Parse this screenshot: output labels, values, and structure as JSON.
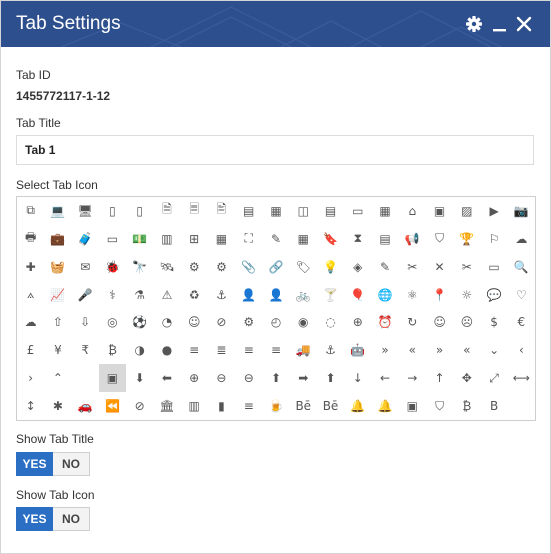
{
  "dialog": {
    "title": "Tab Settings",
    "accent_color": "#2e4f8e",
    "controls": [
      "gear-icon",
      "minimize-icon",
      "close-icon"
    ]
  },
  "tab_id": {
    "label": "Tab ID",
    "value": "1455772117-1-12"
  },
  "tab_title": {
    "label": "Tab Title",
    "value": "Tab 1"
  },
  "icon_picker": {
    "label": "Select Tab Icon",
    "selected_index": 117,
    "selected_color": "#d9d9d9",
    "icons": [
      {
        "name": "files-icon",
        "glyph": "⧉"
      },
      {
        "name": "laptop-icon",
        "glyph": "💻"
      },
      {
        "name": "monitor-icon",
        "glyph": "🖥"
      },
      {
        "name": "tablet-icon",
        "glyph": "▯"
      },
      {
        "name": "phone-icon",
        "glyph": "▯"
      },
      {
        "name": "document-icon",
        "glyph": "🗎"
      },
      {
        "name": "document-text-icon",
        "glyph": "🗏"
      },
      {
        "name": "document-edit-icon",
        "glyph": "🖹"
      },
      {
        "name": "book-icon",
        "glyph": "▤"
      },
      {
        "name": "newspaper-icon",
        "glyph": "▦"
      },
      {
        "name": "book-open-icon",
        "glyph": "◫"
      },
      {
        "name": "list-box-icon",
        "glyph": "▤"
      },
      {
        "name": "id-card-icon",
        "glyph": "▭"
      },
      {
        "name": "calendar-grid-icon",
        "glyph": "▦"
      },
      {
        "name": "presentation-icon",
        "glyph": "⌂"
      },
      {
        "name": "photo-icon",
        "glyph": "▣"
      },
      {
        "name": "image-icon",
        "glyph": "▨"
      },
      {
        "name": "video-icon",
        "glyph": "▶"
      },
      {
        "name": "camera-icon",
        "glyph": "📷"
      },
      {
        "name": "printer-icon",
        "glyph": "🖶"
      },
      {
        "name": "briefcase-icon",
        "glyph": "💼"
      },
      {
        "name": "suitcase-icon",
        "glyph": "🧳"
      },
      {
        "name": "wallet-icon",
        "glyph": "▭"
      },
      {
        "name": "money-icon",
        "glyph": "💵"
      },
      {
        "name": "bar-chart-icon",
        "glyph": "▥"
      },
      {
        "name": "table-icon",
        "glyph": "⊞"
      },
      {
        "name": "grid-icon",
        "glyph": "▦"
      },
      {
        "name": "crop-icon",
        "glyph": "⛶"
      },
      {
        "name": "pencil-box-icon",
        "glyph": "✎"
      },
      {
        "name": "calculator-icon",
        "glyph": "▦"
      },
      {
        "name": "bookmark-icon",
        "glyph": "🔖"
      },
      {
        "name": "hourglass-icon",
        "glyph": "⧗"
      },
      {
        "name": "cash-register-icon",
        "glyph": "▤"
      },
      {
        "name": "megaphone-icon",
        "glyph": "📢"
      },
      {
        "name": "shield-icon",
        "glyph": "⛉"
      },
      {
        "name": "trophy-icon",
        "glyph": "🏆"
      },
      {
        "name": "flag-icon",
        "glyph": "⚐"
      },
      {
        "name": "cloud-network-icon",
        "glyph": "☁"
      },
      {
        "name": "puzzle-icon",
        "glyph": "✚"
      },
      {
        "name": "basket-icon",
        "glyph": "🧺"
      },
      {
        "name": "envelope-open-icon",
        "glyph": "✉"
      },
      {
        "name": "bug-icon",
        "glyph": "🐞"
      },
      {
        "name": "telescope-icon",
        "glyph": "🔭"
      },
      {
        "name": "satellite-icon",
        "glyph": "🛰"
      },
      {
        "name": "gears-icon",
        "glyph": "⚙"
      },
      {
        "name": "cog-icon",
        "glyph": "⚙"
      },
      {
        "name": "paperclip-icon",
        "glyph": "📎"
      },
      {
        "name": "link-icon",
        "glyph": "🔗"
      },
      {
        "name": "tag-icon",
        "glyph": "🏷"
      },
      {
        "name": "lightbulb-icon",
        "glyph": "💡"
      },
      {
        "name": "layers-icon",
        "glyph": "◈"
      },
      {
        "name": "pencil-icon",
        "glyph": "✎"
      },
      {
        "name": "tools-icon",
        "glyph": "✂"
      },
      {
        "name": "wrench-cross-icon",
        "glyph": "✕"
      },
      {
        "name": "scissors-icon",
        "glyph": "✂"
      },
      {
        "name": "paint-roller-icon",
        "glyph": "▭"
      },
      {
        "name": "magnifier-icon",
        "glyph": "🔍"
      },
      {
        "name": "compass-draw-icon",
        "glyph": "⟑"
      },
      {
        "name": "line-chart-icon",
        "glyph": "📈"
      },
      {
        "name": "microphone-icon",
        "glyph": "🎤"
      },
      {
        "name": "lungs-icon",
        "glyph": "⚕"
      },
      {
        "name": "flask-icon",
        "glyph": "⚗"
      },
      {
        "name": "warning-icon",
        "glyph": "⚠"
      },
      {
        "name": "recycle-icon",
        "glyph": "♻"
      },
      {
        "name": "anchor-outline-icon",
        "glyph": "⚓"
      },
      {
        "name": "user-icon",
        "glyph": "👤"
      },
      {
        "name": "user-alt-icon",
        "glyph": "👤"
      },
      {
        "name": "bicycle-icon",
        "glyph": "🚲"
      },
      {
        "name": "cocktail-icon",
        "glyph": "🍸"
      },
      {
        "name": "balloon-icon",
        "glyph": "🎈"
      },
      {
        "name": "globe-stand-icon",
        "glyph": "🌐"
      },
      {
        "name": "atom-icon",
        "glyph": "⚛"
      },
      {
        "name": "location-pin-icon",
        "glyph": "📍"
      },
      {
        "name": "sun-icon",
        "glyph": "☼"
      },
      {
        "name": "chat-icon",
        "glyph": "💬"
      },
      {
        "name": "heart-icon",
        "glyph": "♡"
      },
      {
        "name": "cloud-icon",
        "glyph": "☁"
      },
      {
        "name": "cloud-upload-icon",
        "glyph": "⇧"
      },
      {
        "name": "cloud-download-icon",
        "glyph": "⇩"
      },
      {
        "name": "fingerprint-icon",
        "glyph": "◎"
      },
      {
        "name": "soccer-ball-icon",
        "glyph": "⚽"
      },
      {
        "name": "clock-icon",
        "glyph": "◔"
      },
      {
        "name": "face-icon",
        "glyph": "☺"
      },
      {
        "name": "compass-icon",
        "glyph": "⊘"
      },
      {
        "name": "settings-circle-icon",
        "glyph": "⚙"
      },
      {
        "name": "timer-icon",
        "glyph": "◴"
      },
      {
        "name": "shutter-icon",
        "glyph": "◉"
      },
      {
        "name": "dial-icon",
        "glyph": "◌"
      },
      {
        "name": "crosshair-icon",
        "glyph": "⊕"
      },
      {
        "name": "alarm-icon",
        "glyph": "⏰"
      },
      {
        "name": "refresh-icon",
        "glyph": "↻"
      },
      {
        "name": "smile-icon",
        "glyph": "☺"
      },
      {
        "name": "sad-icon",
        "glyph": "☹"
      },
      {
        "name": "dollar-circle-icon",
        "glyph": "$"
      },
      {
        "name": "euro-circle-icon",
        "glyph": "€"
      },
      {
        "name": "gbp-circle-icon",
        "glyph": "£"
      },
      {
        "name": "yen-circle-icon",
        "glyph": "¥"
      },
      {
        "name": "rupee-circle-icon",
        "glyph": "₹"
      },
      {
        "name": "bitcoin-circle-icon",
        "glyph": "₿"
      },
      {
        "name": "contrast-icon",
        "glyph": "◑"
      },
      {
        "name": "disk-icon",
        "glyph": "●"
      },
      {
        "name": "align-center-icon",
        "glyph": "≡"
      },
      {
        "name": "align-justify-icon",
        "glyph": "≣"
      },
      {
        "name": "align-left-icon",
        "glyph": "≡"
      },
      {
        "name": "align-right-icon",
        "glyph": "≡"
      },
      {
        "name": "truck-icon",
        "glyph": "🚚"
      },
      {
        "name": "anchor-icon",
        "glyph": "⚓"
      },
      {
        "name": "android-icon",
        "glyph": "🤖"
      },
      {
        "name": "double-chevron-down-icon",
        "glyph": "»"
      },
      {
        "name": "double-chevron-left-icon",
        "glyph": "«"
      },
      {
        "name": "double-chevron-right-icon",
        "glyph": "»"
      },
      {
        "name": "double-chevron-up-icon",
        "glyph": "«"
      },
      {
        "name": "chevron-down-icon",
        "glyph": "⌄"
      },
      {
        "name": "chevron-left-icon",
        "glyph": "‹"
      },
      {
        "name": "chevron-right-icon",
        "glyph": "›"
      },
      {
        "name": "chevron-up-icon",
        "glyph": "⌃"
      },
      {
        "name": "apple-icon",
        "glyph": ""
      },
      {
        "name": "archive-icon",
        "glyph": "▣"
      },
      {
        "name": "circle-arrow-down-icon",
        "glyph": "⬇"
      },
      {
        "name": "circle-arrow-left-icon",
        "glyph": "⬅"
      },
      {
        "name": "circle-plus-icon",
        "glyph": "⊕"
      },
      {
        "name": "circle-minus-left-icon",
        "glyph": "⊖"
      },
      {
        "name": "circle-minus-icon",
        "glyph": "⊖"
      },
      {
        "name": "circle-arrow-up-icon",
        "glyph": "⬆"
      },
      {
        "name": "circle-arrow-right-icon",
        "glyph": "➡"
      },
      {
        "name": "circle-arrow-up-alt-icon",
        "glyph": "⬆"
      },
      {
        "name": "arrow-down-icon",
        "glyph": "↓"
      },
      {
        "name": "arrow-left-icon",
        "glyph": "←"
      },
      {
        "name": "arrow-right-icon",
        "glyph": "→"
      },
      {
        "name": "arrow-up-icon",
        "glyph": "↑"
      },
      {
        "name": "move-icon",
        "glyph": "✥"
      },
      {
        "name": "expand-icon",
        "glyph": "⤢"
      },
      {
        "name": "arrows-horizontal-icon",
        "glyph": "⟷"
      },
      {
        "name": "arrows-vertical-icon",
        "glyph": "↕"
      },
      {
        "name": "asterisk-icon",
        "glyph": "✱"
      },
      {
        "name": "car-icon",
        "glyph": "🚗"
      },
      {
        "name": "backward-icon",
        "glyph": "⏪"
      },
      {
        "name": "ban-icon",
        "glyph": "⊘"
      },
      {
        "name": "bank-icon",
        "glyph": "🏛"
      },
      {
        "name": "bar-chart-alt-icon",
        "glyph": "▥"
      },
      {
        "name": "barcode-icon",
        "glyph": "▮"
      },
      {
        "name": "menu-icon",
        "glyph": "≡"
      },
      {
        "name": "beer-icon",
        "glyph": "🍺"
      },
      {
        "name": "behance-icon",
        "glyph": "Bē"
      },
      {
        "name": "behance-square-icon",
        "glyph": "Bē"
      },
      {
        "name": "bell-icon",
        "glyph": "🔔"
      },
      {
        "name": "bell-outline-icon",
        "glyph": "🔔"
      },
      {
        "name": "bicycle-alt-icon",
        "glyph": "▣"
      },
      {
        "name": "bitbucket-icon",
        "glyph": "⛉"
      },
      {
        "name": "bitcoin-icon",
        "glyph": "₿"
      },
      {
        "name": "bold-icon",
        "glyph": "B"
      }
    ]
  },
  "show_tab_title": {
    "label": "Show Tab Title",
    "yes": "YES",
    "no": "NO",
    "value": "YES"
  },
  "show_tab_icon": {
    "label": "Show Tab Icon",
    "yes": "YES",
    "no": "NO",
    "value": "YES"
  },
  "colors": {
    "toggle_active": "#2b6fc4",
    "toggle_inactive": "#f3f3f3"
  }
}
